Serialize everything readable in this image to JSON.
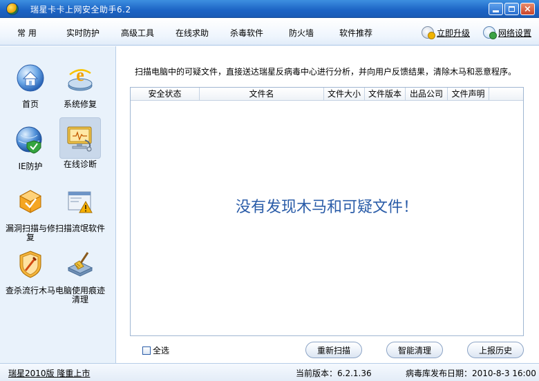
{
  "window": {
    "title": "瑞星卡卡上网安全助手6.2"
  },
  "menu": {
    "items": [
      "常 用",
      "实时防护",
      "高级工具",
      "在线求助",
      "杀毒软件",
      "防火墙",
      "软件推荐"
    ],
    "upgrade_label": "立即升级",
    "network_label": "网络设置"
  },
  "sidebar": {
    "tools": [
      {
        "label": "首页",
        "icon": "home-icon"
      },
      {
        "label": "系统修复",
        "icon": "ie-repair-icon"
      },
      {
        "label": "IE防护",
        "icon": "ie-shield-icon"
      },
      {
        "label": "在线诊断",
        "icon": "online-diagnosis-icon",
        "selected": true
      },
      {
        "label": "漏洞扫描与修复",
        "icon": "vulnerability-scan-icon"
      },
      {
        "label": "扫描流氓软件",
        "icon": "rogue-software-scan-icon"
      },
      {
        "label": "查杀流行木马",
        "icon": "trojan-kill-icon"
      },
      {
        "label": "电脑使用痕迹清理",
        "icon": "trace-clean-icon"
      }
    ]
  },
  "content": {
    "description": "扫描电脑中的可疑文件，直接送达瑞星反病毒中心进行分析，并向用户反馈结果，清除木马和恶意程序。",
    "table": {
      "columns": [
        "安全状态",
        "文件名",
        "文件大小",
        "文件版本",
        "出品公司",
        "文件声明"
      ],
      "rows": []
    },
    "empty_message": "没有发现木马和可疑文件！",
    "select_all_label": "全选",
    "select_all_checked": false,
    "buttons": {
      "rescan": "重新扫描",
      "smart_clean": "智能清理",
      "report_history": "上报历史"
    }
  },
  "status": {
    "promo": "瑞星2010版 隆重上市",
    "version": "当前版本：6.2.1.36",
    "virus_db_date": "病毒库发布日期：2010-8-3 16:00"
  },
  "colors": {
    "titlebar": "#1c63c4",
    "accent_text": "#2a5ca8",
    "sidebar_bg": "#e9f2fb"
  }
}
